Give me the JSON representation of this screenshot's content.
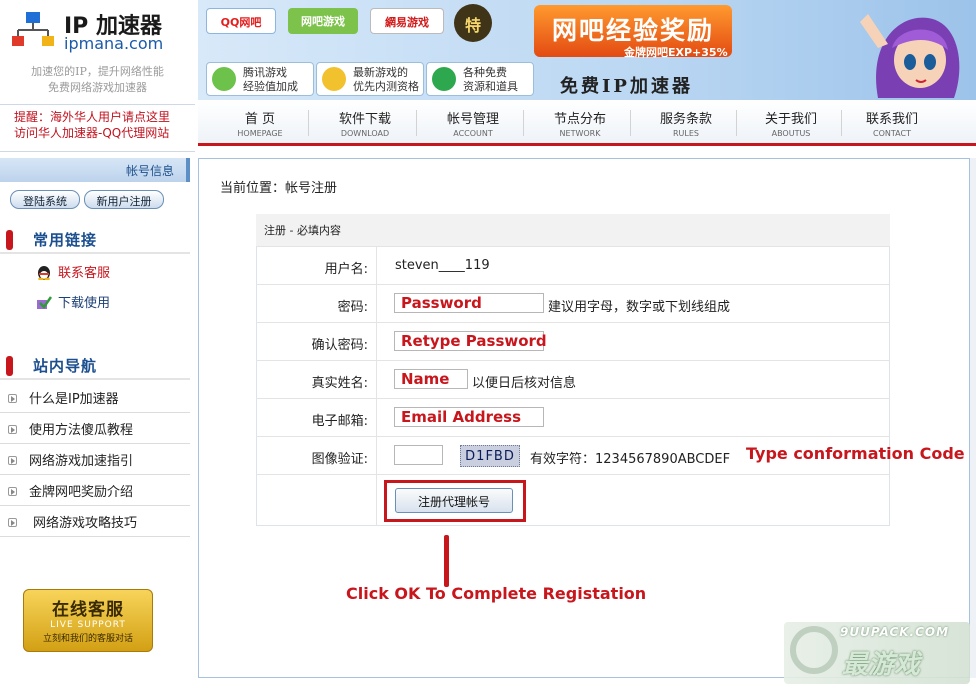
{
  "header": {
    "logo_title": "IP 加速器",
    "logo_domain": "ipmana.com",
    "tagline_line1": "加速您的IP，提升网络性能",
    "tagline_line2": "免费网络游戏加速器",
    "notice_line1": "提醒：海外华人用户请点这里",
    "notice_line2": "访问华人加速器-QQ代理网站"
  },
  "banner": {
    "ad_qq": "QQ网吧",
    "ad_wangba": "网吧游戏",
    "ad_163": "網易游戏",
    "ad_te": "特",
    "promo_title": "网吧经验奖励",
    "promo_sub": "金牌网吧EXP+35%",
    "small_ads": [
      {
        "l1": "腾讯游戏",
        "l2": "经验值加成"
      },
      {
        "l1": "最新游戏的",
        "l2": "优先内测资格"
      },
      {
        "l1": "各种免费",
        "l2": "资源和道具"
      }
    ],
    "free_ip": "免费IP加速器"
  },
  "nav": [
    {
      "cn": "首 页",
      "en": "HOMEPAGE"
    },
    {
      "cn": "软件下载",
      "en": "DOWNLOAD"
    },
    {
      "cn": "帐号管理",
      "en": "ACCOUNT"
    },
    {
      "cn": "节点分布",
      "en": "NETWORK"
    },
    {
      "cn": "服务条款",
      "en": "RULES"
    },
    {
      "cn": "关于我们",
      "en": "ABOUTUS"
    },
    {
      "cn": "联系我们",
      "en": "CONTACT"
    }
  ],
  "sidebar": {
    "account_title": "帐号信息",
    "login_label": "登陆系统",
    "register_label": "新用户注册",
    "links_title": "常用链接",
    "links": [
      "联系客服",
      "下载使用"
    ],
    "nav_title": "站内导航",
    "nav_items": [
      "什么是IP加速器",
      "使用方法傻瓜教程",
      "网络游戏加速指引",
      "金牌网吧奖励介绍",
      "网络游戏攻略技巧"
    ],
    "support_title": "在线客服",
    "support_en": "LIVE SUPPORT",
    "support_sub": "立刻和我们的客服对话"
  },
  "main": {
    "breadcrumb": "当前位置：帐号注册",
    "form_header": "注册 - 必填内容",
    "username_label": "用户名:",
    "username_value": "steven____119",
    "password_label": "密码:",
    "password_placeholder": "Password",
    "password_hint": "建议用字母，数字或下划线组成",
    "confirm_label": "确认密码:",
    "confirm_placeholder": "Retype Password",
    "realname_label": "真实姓名:",
    "realname_placeholder": "Name",
    "realname_hint": "以便日后核对信息",
    "email_label": "电子邮箱:",
    "email_placeholder": "Email Address",
    "captcha_label": "图像验证:",
    "captcha_code": "D1FBD",
    "captcha_hint": "有效字符：1234567890ABCDEF",
    "submit_label": "注册代理帐号"
  },
  "annotations": {
    "type_code": "Type conformation Code",
    "click_ok": "Click OK To Complete Registation"
  },
  "watermark": {
    "site": "9UUPACK.COM",
    "logo": "最游戏"
  },
  "colors": {
    "accent_red": "#c8161d",
    "link_blue": "#1c4f8f",
    "frame_blue": "#a7c2e0"
  }
}
